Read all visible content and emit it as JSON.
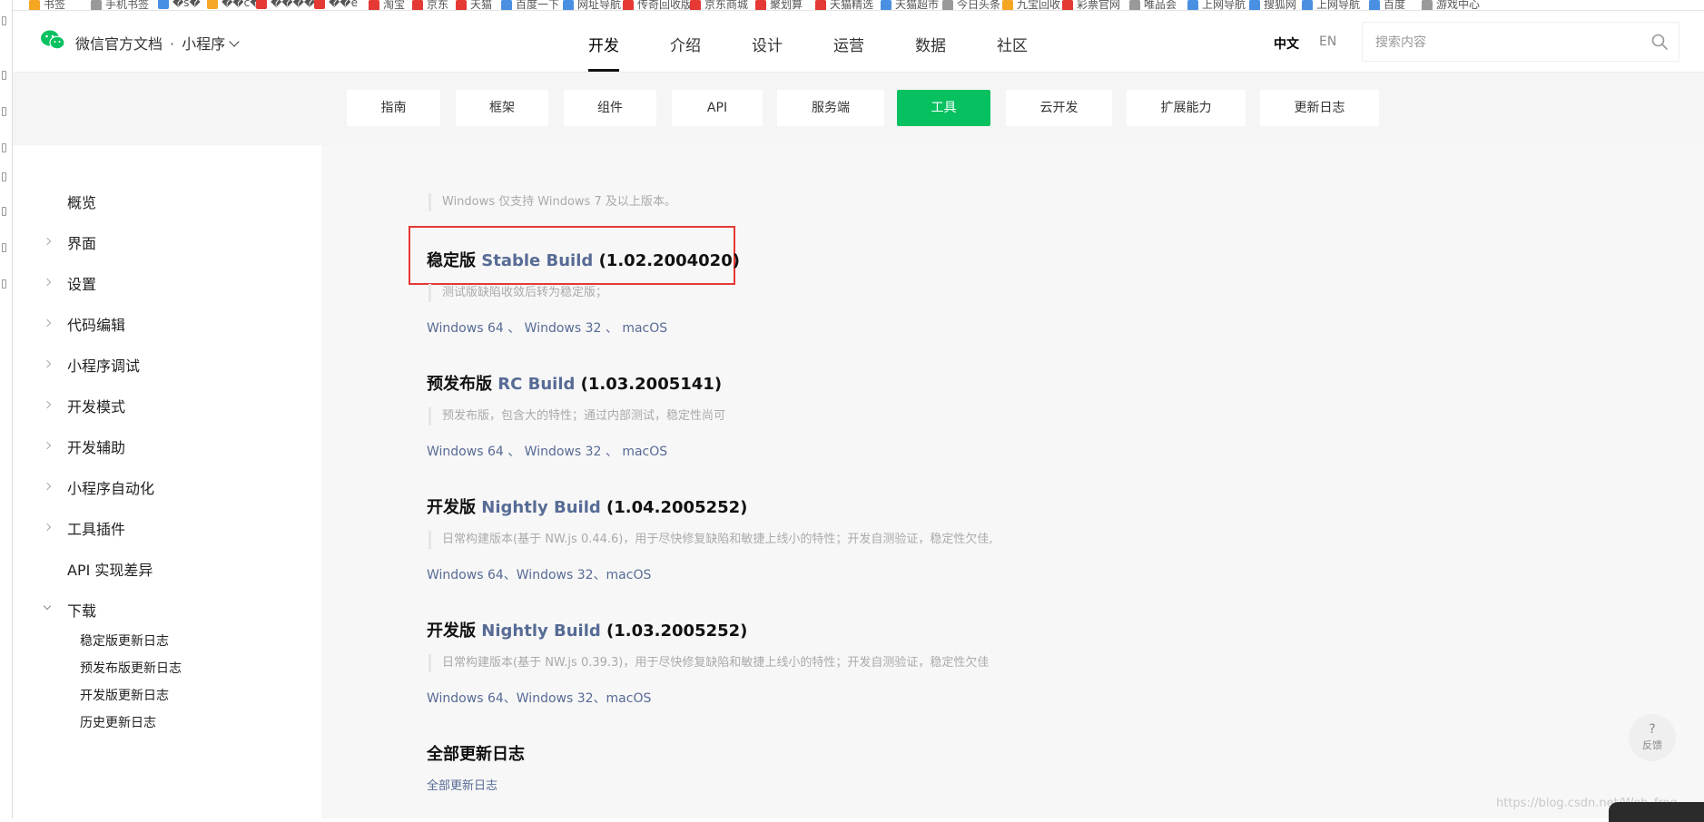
{
  "bookmarks": [
    {
      "label": "书签",
      "color": "#f5a623"
    },
    {
      "label": "手机书签",
      "color": "#999999"
    },
    {
      "label": "�s�",
      "color": "#4a90e2"
    },
    {
      "label": "��c�",
      "color": "#f5a623"
    },
    {
      "label": "����",
      "color": "#e53935"
    },
    {
      "label": "��e",
      "color": "#e53935"
    },
    {
      "label": "淘宝",
      "color": "#e53935"
    },
    {
      "label": "京东",
      "color": "#e53935"
    },
    {
      "label": "天猫",
      "color": "#e53935"
    },
    {
      "label": "百度一下",
      "color": "#4a90e2"
    },
    {
      "label": "网址导航",
      "color": "#4a90e2"
    },
    {
      "label": "传奇回收版",
      "color": "#e53935"
    },
    {
      "label": "京东商城",
      "color": "#e53935"
    },
    {
      "label": "聚划算",
      "color": "#e53935"
    },
    {
      "label": "天猫精选",
      "color": "#e53935"
    },
    {
      "label": "天猫超市",
      "color": "#4a90e2"
    },
    {
      "label": "今日头条",
      "color": "#999999"
    },
    {
      "label": "九宝回收",
      "color": "#f5a623"
    },
    {
      "label": "彩票官网",
      "color": "#e53935"
    },
    {
      "label": "唯品会",
      "color": "#999999"
    },
    {
      "label": "上网导航",
      "color": "#4a90e2"
    },
    {
      "label": "搜狐网",
      "color": "#4a90e2"
    },
    {
      "label": "上网导航",
      "color": "#4a90e2"
    },
    {
      "label": "百度",
      "color": "#4a90e2"
    },
    {
      "label": "游戏中心",
      "color": "#999999"
    }
  ],
  "header": {
    "brand": "微信官方文档",
    "dot": "·",
    "product": "小程序",
    "nav": [
      {
        "label": "开发",
        "active": true
      },
      {
        "label": "介绍"
      },
      {
        "label": "设计"
      },
      {
        "label": "运营"
      },
      {
        "label": "数据"
      },
      {
        "label": "社区"
      }
    ],
    "lang_zh": "中文",
    "lang_en": "EN",
    "search_placeholder": "搜索内容"
  },
  "subtabs": [
    {
      "label": "指南"
    },
    {
      "label": "框架"
    },
    {
      "label": "组件"
    },
    {
      "label": "API"
    },
    {
      "label": "服务端"
    },
    {
      "label": "工具",
      "active": true
    },
    {
      "label": "云开发"
    },
    {
      "label": "扩展能力"
    },
    {
      "label": "更新日志"
    }
  ],
  "sidebar": {
    "items": [
      {
        "label": "概览",
        "arrow": "none"
      },
      {
        "label": "界面",
        "arrow": "right"
      },
      {
        "label": "设置",
        "arrow": "right"
      },
      {
        "label": "代码编辑",
        "arrow": "right"
      },
      {
        "label": "小程序调试",
        "arrow": "right"
      },
      {
        "label": "开发模式",
        "arrow": "right"
      },
      {
        "label": "开发辅助",
        "arrow": "right"
      },
      {
        "label": "小程序自动化",
        "arrow": "right"
      },
      {
        "label": "工具插件",
        "arrow": "right"
      },
      {
        "label": "API 实现差异",
        "arrow": "none"
      },
      {
        "label": "下载",
        "arrow": "down"
      }
    ],
    "sub_items": [
      "稳定版更新日志",
      "预发布版更新日志",
      "开发版更新日志",
      "历史更新日志"
    ]
  },
  "content": {
    "top_note": "Windows 仅支持 Windows 7 及以上版本。",
    "builds": [
      {
        "prefix": "稳定版",
        "name": "Stable Build",
        "version": "(1.02.2004020)",
        "note": "测试版缺陷收敛后转为稳定版；",
        "links": [
          "Windows 64",
          "Windows 32",
          "macOS"
        ],
        "sep": " 、 "
      },
      {
        "prefix": "预发布版",
        "name": "RC Build",
        "version": "(1.03.2005141)",
        "note": "预发布版，包含大的特性；通过内部测试，稳定性尚可",
        "links": [
          "Windows 64",
          "Windows 32",
          "macOS"
        ],
        "sep": " 、 "
      },
      {
        "prefix": "开发版",
        "name": "Nightly Build",
        "version": "(1.04.2005252)",
        "note": "日常构建版本(基于 NW.js 0.44.6)，用于尽快修复缺陷和敏捷上线小的特性；开发自测验证，稳定性欠佳,",
        "links": [
          "Windows 64",
          "Windows 32",
          "macOS"
        ],
        "sep": "、"
      },
      {
        "prefix": "开发版",
        "name": "Nightly Build",
        "version": "(1.03.2005252)",
        "note": "日常构建版本(基于 NW.js 0.39.3)，用于尽快修复缺陷和敏捷上线小的特性；开发自测验证，稳定性欠佳",
        "links": [
          "Windows 64",
          "Windows 32",
          "macOS"
        ],
        "sep": "、"
      }
    ],
    "all_log_title": "全部更新日志",
    "all_log_link": "全部更新日志"
  },
  "feedback": {
    "icon": "?",
    "label": "反馈"
  },
  "watermark": "https://blog.csdn.net/Web_frog"
}
